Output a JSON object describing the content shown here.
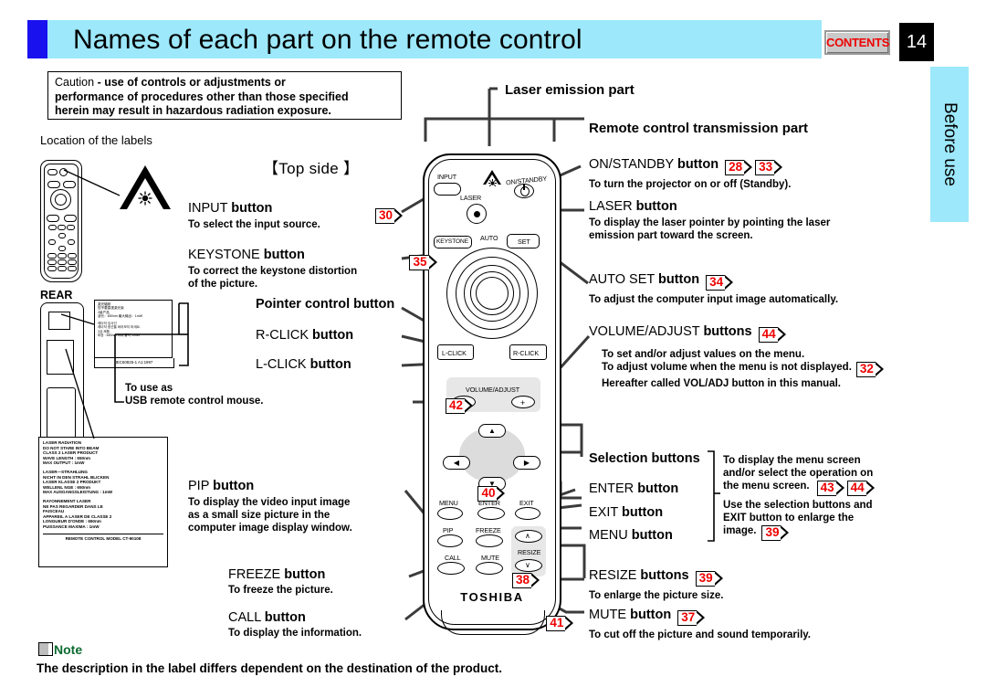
{
  "header": {
    "title": "Names of each part on the remote control",
    "contents_label": "CONTENTS",
    "page_number": "14",
    "side_tab": "Before use"
  },
  "caution": {
    "lead": "Caution",
    "line1": "- use of controls or adjustments or",
    "line2": "performance of procedures other than those specified",
    "line3": "herein may result in hazardous radiation exposure."
  },
  "labels_section": {
    "location_of_labels": "Location of the labels",
    "rear_label": "REAR",
    "top_side_caption": "【Top side 】"
  },
  "warning_label_cjk": {
    "lines": [
      "激光辐射",
      "您不要直视激光束",
      "2级产品",
      "波长：650nm  最大输出：1mW",
      "",
      "레이저 임사선",
      "레이저 광선을 바라보지 마세요.",
      "2급 제품.",
      "파장 : 650nm 최대 출력 :1mW"
    ],
    "footer": "IEC60825-1 A1:1997"
  },
  "laser_radiation_label": {
    "groups": [
      [
        "LASER RADIATION",
        "DO NOT STARE INTO BEAM",
        "CLASS 2 LASER PRODUCT",
        "WAVE LENGTH : 650nm",
        "MAX OUTPUT : 1mW"
      ],
      [
        "LASER—STRAHLUNG",
        "NICHT IN DEN STRAHL BLICKEN",
        "LASER KLASSE 2 PRODUKT",
        "WELLENL NGE : 650nm",
        "MAX AUSGANGSLEISTUNG : 1mW"
      ],
      [
        "RAYONNEMENT LASER",
        "NE PAS REGARDER DANS LE",
        "FAISCEAU",
        "APPAREIL A LASER DE CLASSE 2",
        "LONGUEUR D'ONDE : 650nm",
        "PUISSANCE MAXIMA : 1mW"
      ]
    ],
    "footer": "REMOTE CONTROL  MODEL CT-90108"
  },
  "left_callouts": [
    {
      "title_plain": "INPUT",
      "title_bold": "button",
      "ref": "30",
      "desc": [
        "To select the input source."
      ]
    },
    {
      "title_plain": "KEYSTONE",
      "title_bold": "button",
      "ref": "35",
      "desc": [
        "To correct the keystone distortion",
        "of the picture."
      ]
    },
    {
      "title_plain": "",
      "title_bold": "Pointer control button",
      "ref": "",
      "desc": []
    },
    {
      "title_plain": "R-CLICK",
      "title_bold": "button",
      "ref": "",
      "desc": []
    },
    {
      "title_plain": "L-CLICK",
      "title_bold": "button",
      "ref": "",
      "desc": []
    },
    {
      "title_plain": "PIP",
      "title_bold": "button",
      "ref": "40",
      "desc": [
        "To display the video input image",
        "as a small size picture in the",
        "computer image display window."
      ]
    },
    {
      "title_plain": "FREEZE",
      "title_bold": "button",
      "ref": "38",
      "desc": [
        "To freeze the picture."
      ]
    },
    {
      "title_plain": "CALL",
      "title_bold": "button",
      "ref": "41",
      "desc": [
        "To display the information."
      ]
    }
  ],
  "usb_note": {
    "line1": "To use as",
    "line2": "USB remote control mouse.",
    "ref": "42"
  },
  "right_callouts": [
    {
      "title_bold_only": "Laser emission part"
    },
    {
      "title_bold_only": "Remote control transmission part"
    },
    {
      "title_plain": "ON/STANDBY",
      "title_bold": "button",
      "refs": [
        "28",
        "33"
      ],
      "desc": [
        "To turn the projector on or off (Standby)."
      ]
    },
    {
      "title_plain": "LASER",
      "title_bold": "button",
      "refs": [],
      "desc": [
        "To display the laser pointer by pointing the laser",
        "emission part toward the screen."
      ]
    },
    {
      "title_plain": "AUTO SET",
      "title_bold": "button",
      "refs": [
        "34"
      ],
      "desc": [
        "To adjust the computer input image automatically."
      ]
    },
    {
      "title_plain": "VOLUME/ADJUST",
      "title_bold": "buttons",
      "refs": [
        "44"
      ],
      "desc": [
        "To set and/or adjust values on the menu.",
        "To adjust volume when the menu is not displayed.",
        "Hereafter called  VOL/ADJ  button  in this manual."
      ],
      "inline_ref": "32"
    },
    {
      "title_bold_only": "Selection buttons"
    },
    {
      "title_plain": "ENTER",
      "title_bold": "button"
    },
    {
      "title_plain": "EXIT",
      "title_bold": "button"
    },
    {
      "title_plain": "MENU",
      "title_bold": "button"
    },
    {
      "title_plain": "RESIZE",
      "title_bold": "buttons",
      "refs": [
        "39"
      ],
      "desc": [
        "To enlarge the picture size."
      ]
    },
    {
      "title_plain": "MUTE",
      "title_bold": "button",
      "refs": [
        "37"
      ],
      "desc": [
        "To cut off the picture and sound temporarily."
      ]
    }
  ],
  "selection_group_desc": {
    "line1": "To display the menu screen",
    "line2": "and/or select the operation on",
    "line3": "the menu screen.",
    "refs": [
      "43",
      "44"
    ],
    "line4": "Use the selection buttons and",
    "line5": "EXIT button to enlarge the",
    "line6": "image.",
    "ref2": "39"
  },
  "remote_diagram": {
    "buttons": [
      "INPUT",
      "ON/STANDBY",
      "LASER",
      "KEYSTONE",
      "AUTO",
      "SET",
      "L-CLICK",
      "R-CLICK",
      "VOLUME/ADJUST",
      "MENU",
      "ENTER",
      "EXIT",
      "PIP",
      "FREEZE",
      "RESIZE",
      "CALL",
      "MUTE"
    ],
    "brand": "TOSHIBA",
    "minus": "−",
    "plus": "+",
    "up": "▲",
    "down": "▼",
    "left": "◀",
    "right": "▶",
    "chev_up": "∧",
    "chev_down": "∨",
    "power": "⏻"
  },
  "note": {
    "label": "Note",
    "text": "The description in the label differs dependent on the destination of the product."
  },
  "colors": {
    "header_band": "#9de8fb",
    "header_square": "#1a11ef",
    "ref_red": "#ee0000",
    "note_green": "#0b6b31",
    "leader": "#3b3b3b"
  }
}
